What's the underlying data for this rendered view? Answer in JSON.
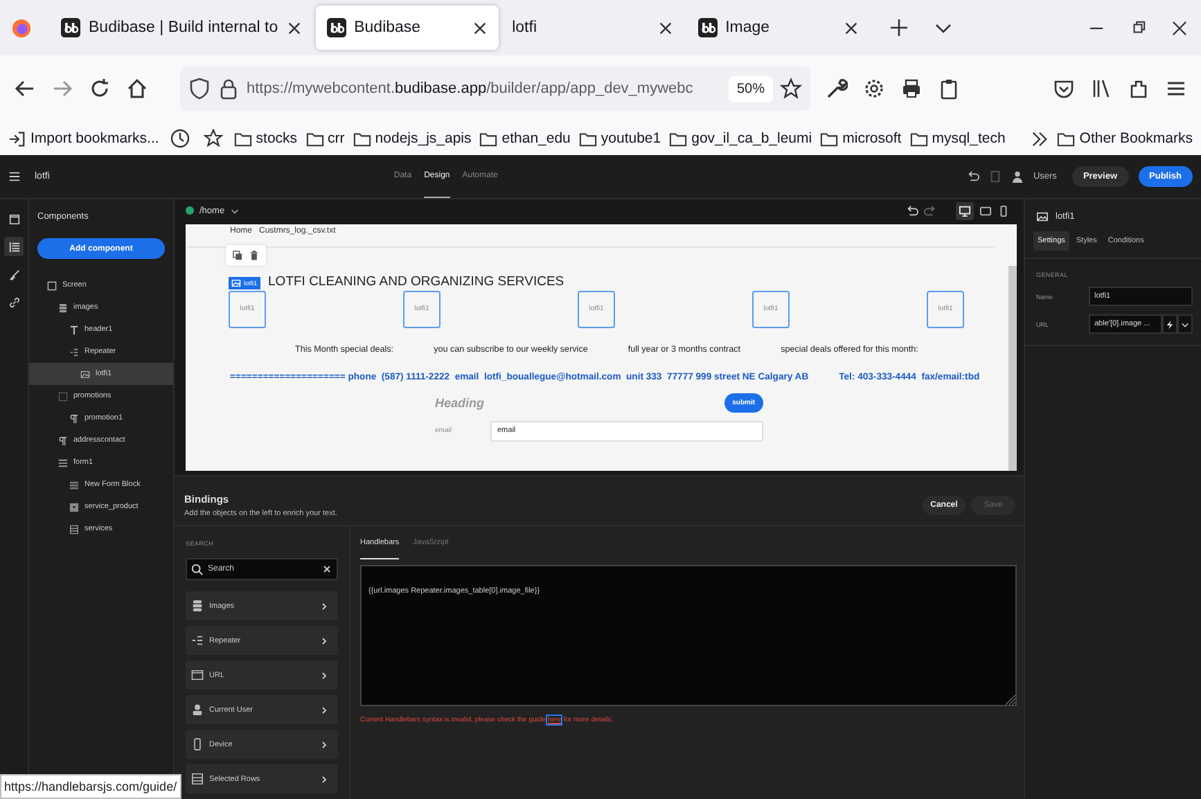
{
  "browser": {
    "tabs": [
      {
        "title": "Budibase | Build internal to",
        "kind": "app",
        "selected": false
      },
      {
        "title": "Budibase",
        "kind": "app",
        "selected": true
      },
      {
        "title": "lotfi",
        "kind": "blank",
        "selected": false
      },
      {
        "title": "Image",
        "kind": "app",
        "selected": false
      }
    ],
    "address": {
      "scheme": "https://mywebcontent.",
      "host": "budibase.app",
      "path": "/builder/app/app_dev_mywebc"
    },
    "zoom": "50%",
    "bookmarks": [
      {
        "kind": "import",
        "label": "Import bookmarks..."
      },
      {
        "kind": "history"
      },
      {
        "kind": "starred"
      },
      {
        "kind": "folder",
        "label": "stocks"
      },
      {
        "kind": "folder",
        "label": "crr"
      },
      {
        "kind": "folder",
        "label": "nodejs_js_apis"
      },
      {
        "kind": "folder",
        "label": "ethan_edu"
      },
      {
        "kind": "folder",
        "label": "youtube1"
      },
      {
        "kind": "folder",
        "label": "gov_il_ca_b_leumi"
      },
      {
        "kind": "folder",
        "label": "microsoft"
      },
      {
        "kind": "folder",
        "label": "mysql_tech"
      }
    ],
    "other_bookmarks": "Other Bookmarks"
  },
  "app": {
    "title": "lotfi",
    "nav": [
      {
        "label": "Data",
        "selected": false
      },
      {
        "label": "Design",
        "selected": true
      },
      {
        "label": "Automate",
        "selected": false
      }
    ],
    "users": "Users",
    "preview": "Preview",
    "publish": "Publish"
  },
  "rail": [
    {
      "kind": "screens",
      "selected": false
    },
    {
      "kind": "components",
      "selected": true
    },
    {
      "kind": "theme",
      "selected": false
    },
    {
      "kind": "links",
      "selected": false
    }
  ],
  "components": {
    "title": "Components",
    "add_button": "Add component",
    "tree": [
      {
        "label": "Screen",
        "kind": "screen",
        "selected": false,
        "children": [
          {
            "label": "images",
            "kind": "data",
            "selected": false,
            "children": [
              {
                "label": "header1",
                "kind": "text",
                "selected": false
              },
              {
                "label": "Repeater",
                "kind": "repeater",
                "selected": false,
                "children": [
                  {
                    "label": "lotfi1",
                    "kind": "image",
                    "selected": true
                  }
                ]
              }
            ]
          },
          {
            "label": "promotions",
            "kind": "container",
            "selected": false,
            "children": [
              {
                "label": "promotion1",
                "kind": "paragraph",
                "selected": false
              }
            ]
          },
          {
            "label": "addresscontact",
            "kind": "paragraph",
            "selected": false
          },
          {
            "label": "form1",
            "kind": "form",
            "selected": false,
            "children": [
              {
                "label": "New Form Block",
                "kind": "formblock",
                "selected": false
              },
              {
                "label": "service_product",
                "kind": "select",
                "selected": false
              },
              {
                "label": "services",
                "kind": "table",
                "selected": false
              }
            ]
          }
        ]
      }
    ]
  },
  "route": "/home",
  "canvas": {
    "nav": [
      "Home",
      "Custmrs_log._csv.txt"
    ],
    "badge": "lotfi1",
    "title": "LOTFI CLEANING AND ORGANIZING SERVICES",
    "images": [
      "lotfi1",
      "lotfi1",
      "lotfi1",
      "lotfi1",
      "lotfi1"
    ],
    "deals": [
      "This Month special deals:",
      "you can subscribe to our weekly service",
      "full year or 3 months contract",
      "special deals offered for this month:"
    ],
    "contact": [
      "===================== phone  (587) 1111-2222  email  lotfi_bouallegue@hotmail.com  unit 333  77777 999 street NE Calgary AB",
      "Tel: 403-333-4444  fax/email:tbd"
    ],
    "form": {
      "heading": "Heading",
      "submit": "submit",
      "field_label": "email",
      "field_value": "email"
    }
  },
  "bindings": {
    "title": "Bindings",
    "description": "Add the objects on the left to enrich your text.",
    "cancel": "Cancel",
    "save": "Save",
    "save_disabled": true,
    "search_label": "SEARCH",
    "search_placeholder": "Search",
    "categories": [
      {
        "kind": "data",
        "label": "Images"
      },
      {
        "kind": "repeater",
        "label": "Repeater"
      },
      {
        "kind": "url",
        "label": "URL"
      },
      {
        "kind": "user",
        "label": "Current User"
      },
      {
        "kind": "device",
        "label": "Device"
      },
      {
        "kind": "rows",
        "label": "Selected Rows"
      }
    ],
    "tabs": [
      {
        "label": "Handlebars",
        "selected": true
      },
      {
        "label": "JavaScript",
        "selected": false
      }
    ],
    "expression": "{{url.images Repeater.images_table[0].image_file}}",
    "error_before": "Current Handlebars syntax is invalid, please check the guide ",
    "error_link": "here",
    "error_after": " for more details."
  },
  "settings": {
    "component": "lotfi1",
    "tabs": [
      {
        "label": "Settings",
        "selected": true
      },
      {
        "label": "Styles",
        "selected": false
      },
      {
        "label": "Conditions",
        "selected": false
      }
    ],
    "section": "GENERAL",
    "fields": [
      {
        "label": "Name",
        "value": "lotfi1",
        "kind": "text"
      },
      {
        "label": "URL",
        "value": "able'[0].image ...",
        "kind": "binding"
      }
    ]
  },
  "status_url": "https://handlebarsjs.com/guide/"
}
